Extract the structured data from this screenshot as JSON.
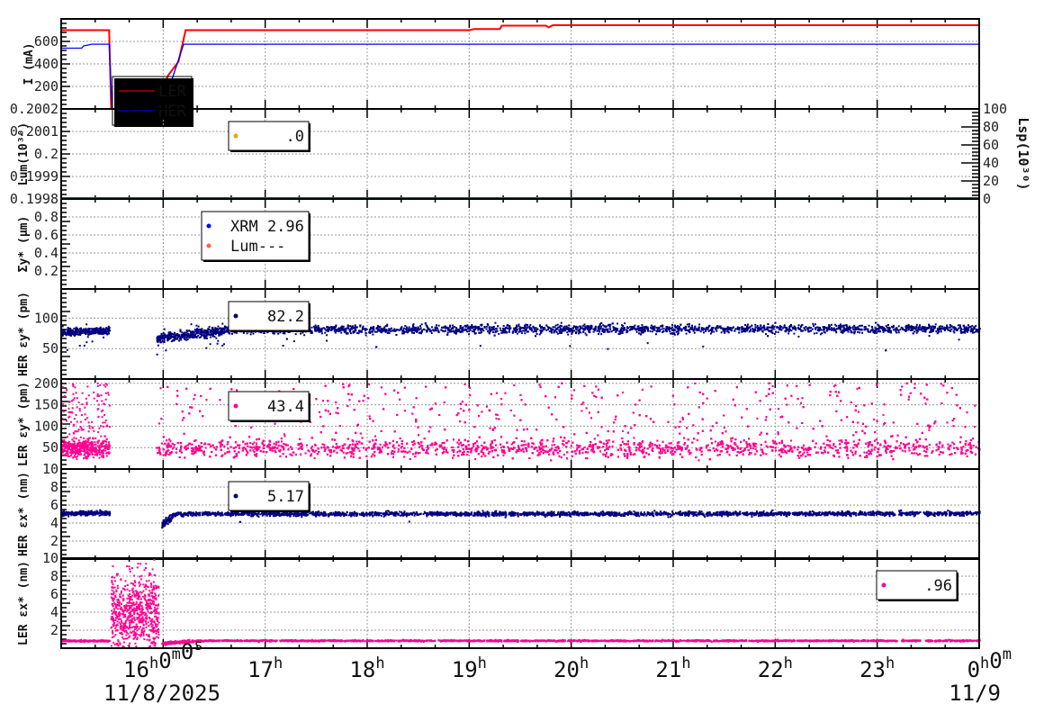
{
  "colors": {
    "ler": "#ff0000",
    "her": "#0000ff",
    "her_pts": "#000080",
    "ler_pts": "#ff0090",
    "lum": "#f0a000",
    "lum_leg": "#ff6040",
    "lum_line": "#306000"
  },
  "chart_data": {
    "type": "scatter",
    "time_range_hours": [
      15,
      24
    ],
    "x_ticks": [
      {
        "t": 16,
        "parts": [
          [
            "16",
            "h"
          ],
          [
            "0",
            "m"
          ],
          [
            "0",
            "s"
          ]
        ]
      },
      {
        "t": 17,
        "parts": [
          [
            "17",
            "h"
          ]
        ]
      },
      {
        "t": 18,
        "parts": [
          [
            "18",
            "h"
          ]
        ]
      },
      {
        "t": 19,
        "parts": [
          [
            "19",
            "h"
          ]
        ]
      },
      {
        "t": 20,
        "parts": [
          [
            "20",
            "h"
          ]
        ]
      },
      {
        "t": 21,
        "parts": [
          [
            "21",
            "h"
          ]
        ]
      },
      {
        "t": 22,
        "parts": [
          [
            "22",
            "h"
          ]
        ]
      },
      {
        "t": 23,
        "parts": [
          [
            "23",
            "h"
          ]
        ]
      },
      {
        "t": 24,
        "parts": [
          [
            "0",
            "h"
          ],
          [
            "0",
            "m"
          ]
        ]
      }
    ],
    "dates": {
      "start": "11/8/2025",
      "end": "11/9"
    },
    "panels": [
      {
        "id": "current",
        "ylabel": "I (mA)",
        "ylim": [
          0,
          800
        ],
        "yticks": [
          200,
          400,
          600
        ],
        "ytick_labels": [
          "200",
          "400",
          "600"
        ],
        "legend": [
          {
            "label": "LER",
            "color": "#ff0000",
            "type": "line"
          },
          {
            "label": "HER",
            "color": "#0000ff",
            "type": "line"
          }
        ],
        "lines": [
          {
            "name": "LER",
            "color": "#ff0000",
            "points": [
              [
                15,
                700
              ],
              [
                15.47,
                700
              ],
              [
                15.48,
                350
              ],
              [
                15.49,
                0
              ],
              [
                15.9,
                0
              ],
              [
                15.95,
                100
              ],
              [
                16.05,
                300
              ],
              [
                16.15,
                420
              ],
              [
                16.22,
                700
              ],
              [
                19.0,
                700
              ],
              [
                19.05,
                710
              ],
              [
                19.3,
                710
              ],
              [
                19.32,
                740
              ],
              [
                19.75,
                740
              ],
              [
                19.78,
                725
              ],
              [
                19.82,
                744
              ],
              [
                24,
                744
              ]
            ]
          },
          {
            "name": "HER",
            "color": "#0000ff",
            "points": [
              [
                15,
                540
              ],
              [
                15.2,
                540
              ],
              [
                15.22,
                560
              ],
              [
                15.3,
                575
              ],
              [
                15.47,
                575
              ],
              [
                15.5,
                0
              ],
              [
                15.98,
                0
              ],
              [
                16.1,
                300
              ],
              [
                16.2,
                575
              ],
              [
                24,
                575
              ]
            ]
          }
        ]
      },
      {
        "id": "lum",
        "ylabel": "Lum(10³⁰)",
        "ylim": [
          0.1998,
          0.2002
        ],
        "yticks": [
          0.1999,
          0.2,
          0.2001
        ],
        "ytick_labels": [
          "0.1998",
          "0.1999",
          "0.2",
          "0.2001",
          "0.2002"
        ],
        "right_ylabel": "Lsp(10³⁰)",
        "right_ylim": [
          0,
          100
        ],
        "right_tick_labels": [
          "0",
          "20",
          "40",
          "60",
          "80",
          "100"
        ],
        "legend": [
          {
            "label": ".0",
            "color": "#f0a000",
            "type": "dot"
          }
        ]
      },
      {
        "id": "sigma",
        "ylabel": "Σy* (μm)",
        "ylim": [
          0,
          1
        ],
        "yticks": [
          0.2,
          0.4,
          0.6,
          0.8
        ],
        "ytick_labels": [
          "0.2",
          "0.4",
          "0.6",
          "0.8"
        ],
        "legend": [
          {
            "label": "XRM 2.96",
            "color": "#0000ff",
            "type": "dot"
          },
          {
            "label": "Lum---",
            "color": "#ff6040",
            "type": "dot"
          }
        ]
      },
      {
        "id": "her_ey",
        "ylabel": "HER εy* (pm)",
        "ylim": [
          0,
          148
        ],
        "yticks": [
          50,
          100
        ],
        "ytick_labels": [
          "50",
          "100"
        ],
        "legend": [
          {
            "label": "82.2",
            "color": "#000080",
            "type": "dot"
          }
        ],
        "color": "#000080",
        "segments": [
          {
            "t": [
              15,
              15.47
            ],
            "c": [
              76,
              80
            ],
            "s": 3,
            "n": 300,
            "out": 0.02
          },
          {
            "t": [
              15.93,
              16.6
            ],
            "c": [
              66,
              80
            ],
            "s": 4,
            "n": 400,
            "out": 0.05
          },
          {
            "t": [
              16.6,
              24
            ],
            "c": [
              81,
              83
            ],
            "s": 3.5,
            "n": 2600,
            "out": 0.01
          }
        ]
      },
      {
        "id": "ler_ey",
        "ylabel": "LER εy* (pm)",
        "ylim": [
          0,
          210
        ],
        "yticks": [
          50,
          100,
          150,
          200
        ],
        "ytick_labels": [
          "50",
          "100",
          "150",
          "200"
        ],
        "legend": [
          {
            "label": "43.4",
            "color": "#ff0090",
            "type": "dot"
          }
        ],
        "color": "#ff0090",
        "segments": [
          {
            "t": [
              15,
              15.47
            ],
            "c": [
              48,
              48
            ],
            "s": 10,
            "n": 500,
            "out": 0.25,
            "omax": 200
          },
          {
            "t": [
              15.93,
              24
            ],
            "c": [
              48,
              48
            ],
            "s": 10,
            "n": 6500,
            "out": 0.25,
            "omax": 200
          }
        ]
      },
      {
        "id": "her_ex",
        "ylabel": "HER εx* (nm)",
        "ylim": [
          0,
          10
        ],
        "yticks": [
          2,
          4,
          6,
          8
        ],
        "ytick_labels": [
          "2",
          "4",
          "6",
          "8",
          "10"
        ],
        "legend": [
          {
            "label": "5.17",
            "color": "#000080",
            "type": "dot"
          }
        ],
        "color": "#000080",
        "segments": [
          {
            "t": [
              15,
              15.47
            ],
            "c": [
              5.05,
              5.1
            ],
            "s": 0.12,
            "n": 300,
            "out": 0
          },
          {
            "t": [
              15.98,
              16.1
            ],
            "c": [
              3.8,
              4.9
            ],
            "s": 0.2,
            "n": 80,
            "out": 0
          },
          {
            "t": [
              16.1,
              24
            ],
            "c": [
              5.0,
              5.05
            ],
            "s": 0.12,
            "n": 2800,
            "out": 0.002
          }
        ]
      },
      {
        "id": "ler_ex",
        "ylabel": "LER εx* (nm)",
        "ylim": [
          0,
          10
        ],
        "yticks": [
          2,
          4,
          6,
          8
        ],
        "ytick_labels": [
          "2",
          "4",
          "6",
          "8",
          "10"
        ],
        "legend": [
          {
            "label": ".96",
            "color": "#ff0090",
            "type": "dot"
          }
        ],
        "color": "#ff0090",
        "segments": [
          {
            "t": [
              15,
              15.47
            ],
            "c": [
              0.8,
              0.8
            ],
            "s": 0.05,
            "n": 200,
            "out": 0
          },
          {
            "t": [
              15.48,
              15.95
            ],
            "c": [
              4,
              4
            ],
            "s": 2.3,
            "n": 700,
            "out": 0
          },
          {
            "t": [
              15.98,
              16.3
            ],
            "c": [
              0.5,
              0.8
            ],
            "s": 0.08,
            "n": 150,
            "out": 0
          },
          {
            "t": [
              16.3,
              24
            ],
            "c": [
              0.82,
              0.82
            ],
            "s": 0.04,
            "n": 2500,
            "out": 0.002
          }
        ]
      }
    ]
  }
}
